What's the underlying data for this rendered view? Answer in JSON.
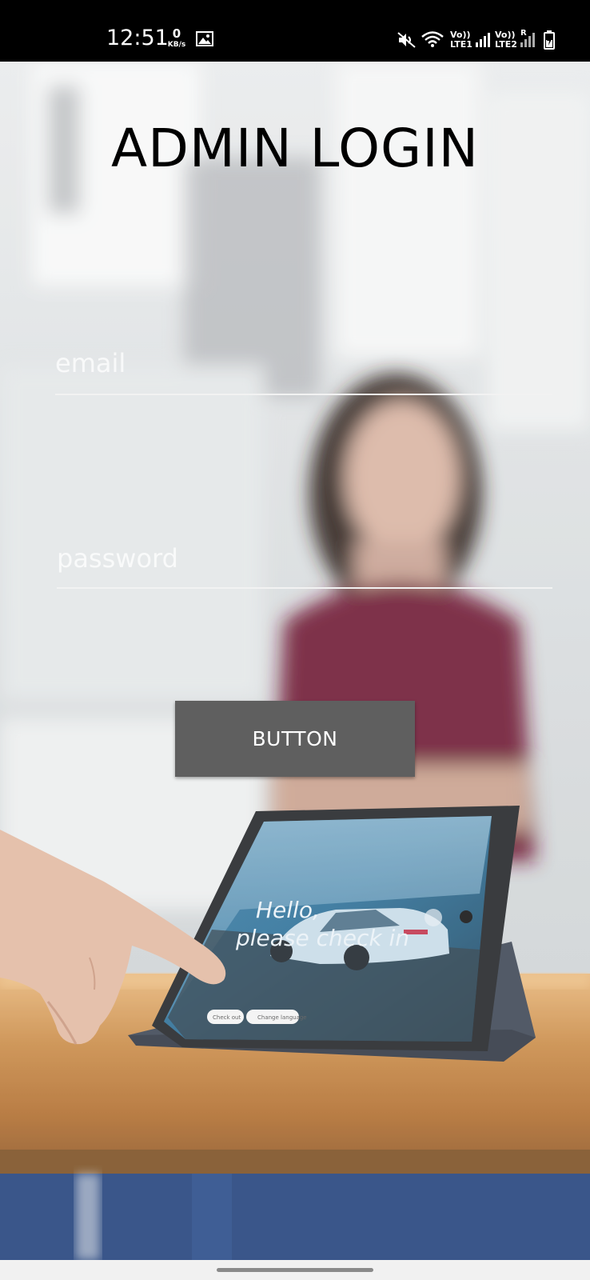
{
  "status_bar": {
    "time": "12:51",
    "speed_value": "0",
    "speed_unit": "KB/s",
    "sim1_label_top": "Vo))",
    "sim1_label_bottom": "LTE1",
    "sim2_label_top": "Vo))",
    "sim2_label_bottom": "LTE2",
    "roaming": "R",
    "icons": [
      "image-icon",
      "mute-icon",
      "wifi-icon",
      "signal-icon",
      "signal-icon",
      "battery-charging-icon"
    ]
  },
  "login": {
    "title": "ADMIN LOGIN",
    "email_placeholder": "email",
    "password_placeholder": "password",
    "button_label": "BUTTON"
  },
  "background_photo": {
    "tablet_text_line1": "Hello,",
    "tablet_text_line2": "please check in",
    "tablet_btn_1": "Check out",
    "tablet_btn_2": "Change language"
  }
}
